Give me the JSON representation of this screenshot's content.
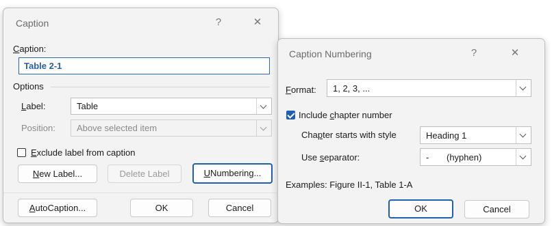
{
  "caption_dialog": {
    "title": "Caption",
    "help_icon": "?",
    "close_icon": "✕",
    "caption_label_pre": "",
    "caption_label_u": "C",
    "caption_label_post": "aption:",
    "caption_value": "Table 2-1",
    "options_heading": "Options",
    "label_label_u": "L",
    "label_label_post": "abel:",
    "label_value": "Table",
    "position_label": "Position:",
    "position_value": "Above selected item",
    "exclude_label_u": "E",
    "exclude_label_post": "xclude label from caption",
    "exclude_checked": false,
    "new_label_u": "N",
    "new_label_post": "ew Label...",
    "delete_label": "Delete Label",
    "numbering_u": "U",
    "numbering_post": "Numbering...",
    "autocaption_u": "A",
    "autocaption_post": "utoCaption...",
    "ok": "OK",
    "cancel": "Cancel"
  },
  "numbering_dialog": {
    "title": "Caption Numbering",
    "help_icon": "?",
    "close_icon": "✕",
    "format_label_u": "F",
    "format_label_post": "ormat:",
    "format_value": "1, 2, 3, ...",
    "include_pre": "Include ",
    "include_u": "c",
    "include_post": "hapter number",
    "include_checked": true,
    "chapter_style_pre": "Cha",
    "chapter_style_u": "p",
    "chapter_style_post": "ter starts with style",
    "chapter_style_value": "Heading 1",
    "separator_pre": "Use ",
    "separator_u": "s",
    "separator_post": "eparator:",
    "separator_char": "-",
    "separator_name": "(hyphen)",
    "examples": "Examples:  Figure II-1, Table 1-A",
    "ok": "OK",
    "cancel": "Cancel"
  }
}
